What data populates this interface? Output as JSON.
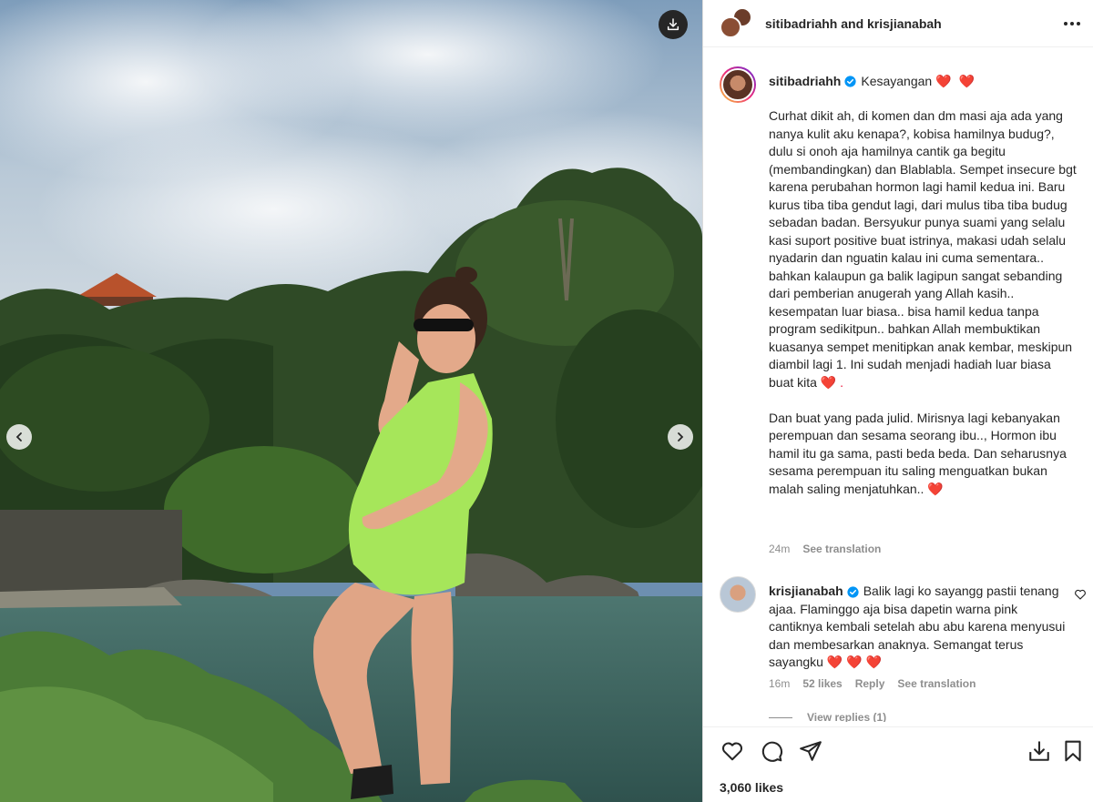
{
  "header": {
    "title": "sitibadriahh and krisjianabah"
  },
  "caption": {
    "username": "sitibadriahh",
    "title_text": "Kesayangan",
    "title_hearts": "❤️ ❤️",
    "paragraph1": "Curhat dikit ah, di komen dan dm masi aja ada yang nanya kulit aku kenapa?, kobisa hamilnya budug?, dulu si onoh aja hamilnya cantik ga begitu (membandingkan) dan Blablabla. Sempet insecure bgt karena perubahan hormon lagi hamil kedua ini. Baru kurus tiba tiba gendut lagi, dari mulus tiba tiba budug sebadan badan. Bersyukur punya suami yang selalu kasi suport positive buat istrinya, makasi udah selalu nyadarin dan nguatin kalau ini cuma sementara.. bahkan kalaupun ga balik lagipun sangat sebanding dari pemberian anugerah yang Allah kasih.. kesempatan luar biasa.. bisa hamil kedua tanpa program sedikitpun.. bahkan Allah membuktikan kuasanya sempet menitipkan anak kembar, meskipun diambil lagi 1. Ini sudah menjadi hadiah luar biasa buat kita",
    "paragraph1_end": "❤️ .",
    "paragraph2": "Dan buat yang pada julid. Mirisnya lagi kebanyakan perempuan dan sesama seorang ibu.., Hormon ibu hamil itu ga sama, pasti beda beda. Dan seharusnya sesama perempuan itu saling menguatkan bukan malah saling menjatuhkan..",
    "paragraph2_end": "❤️",
    "time": "24m",
    "see_translation": "See translation"
  },
  "comment": {
    "username": "krisjianabah",
    "text": "Balik lagi ko sayangg pastii tenang ajaa. Flaminggo aja bisa dapetin warna pink cantiknya kembali setelah abu abu karena menyusui dan membesarkan anaknya. Semangat terus sayangku",
    "text_end": "❤️ ❤️ ❤️",
    "time": "16m",
    "likes": "52 likes",
    "reply": "Reply",
    "see_translation": "See translation",
    "view_replies": "View replies (1)"
  },
  "footer": {
    "likes": "3,060 likes"
  },
  "icons": {
    "download": "download-icon",
    "prev": "chevron-left-icon",
    "next": "chevron-right-icon",
    "more": "more-horizontal-icon",
    "verified": "verified-badge-icon",
    "like": "heart-icon",
    "comment": "comment-icon",
    "share": "send-icon",
    "save": "bookmark-icon",
    "save_collection": "save-to-collection-icon"
  },
  "colors": {
    "verified": "#0095f6",
    "heart": "#ed1c40",
    "muted": "#8e8e8e",
    "text": "#262626"
  }
}
